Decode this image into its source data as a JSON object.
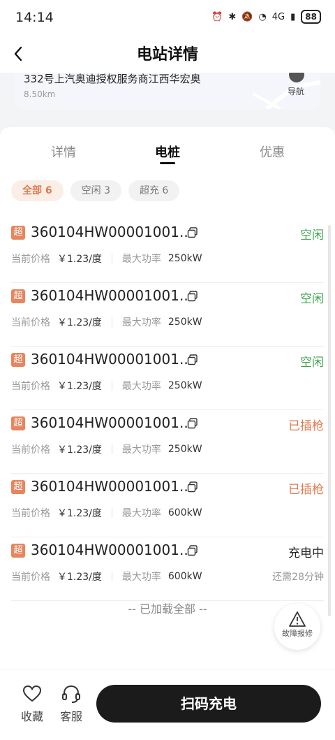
{
  "status_bar": {
    "time": "14:14",
    "network": "4G",
    "battery": "88"
  },
  "header": {
    "title": "电站详情"
  },
  "station": {
    "address": "332号上汽奥迪授权服务商江西华宏奥",
    "distance": "8.50km",
    "nav_label": "导航"
  },
  "tabs": [
    {
      "label": "详情"
    },
    {
      "label": "电桩"
    },
    {
      "label": "优惠"
    }
  ],
  "active_tab": "电桩",
  "filters": [
    {
      "label": "全部 6"
    },
    {
      "label": "空闲 3"
    },
    {
      "label": "超充 6"
    }
  ],
  "price_label": "当前价格",
  "power_label": "最大功率",
  "piles": [
    {
      "badge": "超",
      "id": "360104HW00001001...",
      "price": "￥1.23/度",
      "power": "250kW",
      "status": "空闲",
      "status_color": "#3fa34d",
      "remaining": ""
    },
    {
      "badge": "超",
      "id": "360104HW00001001...",
      "price": "￥1.23/度",
      "power": "250kW",
      "status": "空闲",
      "status_color": "#3fa34d",
      "remaining": ""
    },
    {
      "badge": "超",
      "id": "360104HW00001001...",
      "price": "￥1.23/度",
      "power": "250kW",
      "status": "空闲",
      "status_color": "#3fa34d",
      "remaining": ""
    },
    {
      "badge": "超",
      "id": "360104HW00001001...",
      "price": "￥1.23/度",
      "power": "250kW",
      "status": "已插枪",
      "status_color": "#e07a4d",
      "remaining": ""
    },
    {
      "badge": "超",
      "id": "360104HW00001001...",
      "price": "￥1.23/度",
      "power": "600kW",
      "status": "已插枪",
      "status_color": "#e07a4d",
      "remaining": ""
    },
    {
      "badge": "超",
      "id": "360104HW00001001...",
      "price": "￥1.23/度",
      "power": "600kW",
      "status": "充电中",
      "status_color": "#222222",
      "remaining": "还需28分钟"
    }
  ],
  "loaded_text": "-- 已加载全部 --",
  "fault_report": "故障报修",
  "bottom": {
    "favorite": "收藏",
    "service": "客服",
    "scan_charge": "扫码充电"
  }
}
